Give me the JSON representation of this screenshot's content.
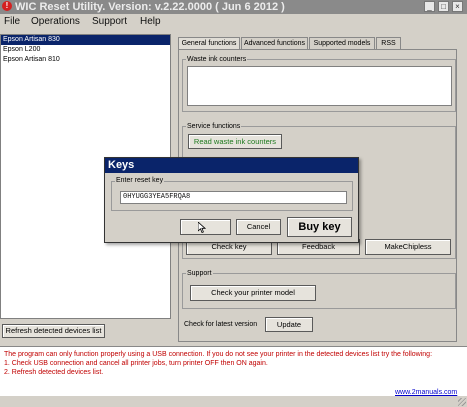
{
  "window": {
    "title": "WIC Reset Utility. Version: v.2.22.0000 ( Jun  6 2012 )",
    "app_icon_glyph": "!",
    "controls": {
      "minimize": "_",
      "maximize": "□",
      "close": "×"
    }
  },
  "menu": [
    "File",
    "Operations",
    "Support",
    "Help"
  ],
  "devices": {
    "items": [
      "Epson Artisan 830",
      "Epson L200",
      "Epson Artisan 810"
    ],
    "selected_index": 0,
    "refresh_label": "Refresh detected devices list"
  },
  "tabs": [
    "General functions",
    "Advanced functions",
    "Supported models",
    "RSS"
  ],
  "active_tab": 0,
  "general": {
    "waste_label": "Waste ink counters",
    "service_label": "Service functions",
    "read_waste_label": "Read waste ink counters",
    "check_key_label": "Check key",
    "feedback_label": "Feedback",
    "makechipless_label": "MakeChipless",
    "support_label": "Support",
    "check_printer_label": "Check your printer model",
    "latest_label": "Check for latest version",
    "update_label": "Update"
  },
  "keys_dialog": {
    "title": "Keys",
    "group_label": "Enter reset key",
    "key_value": "0HYUGG3YEA5FRQA8",
    "ok_label": "",
    "cancel_label": "Cancel",
    "buy_label": "Buy key"
  },
  "status": {
    "lines": [
      "The program can only function properly using a USB connection. If you do not see your printer in the detected devices list try the following:",
      "1. Check USB connection and cancel all printer jobs, turn printer OFF then ON again.",
      "2. Refresh detected devices list."
    ],
    "footer_link": "www.2manuals.com"
  },
  "colors": {
    "status_text": "#c00000",
    "dialog_title": "#0a246a",
    "read_waste_text": "#1e7a1e",
    "link": "#0000cc"
  }
}
